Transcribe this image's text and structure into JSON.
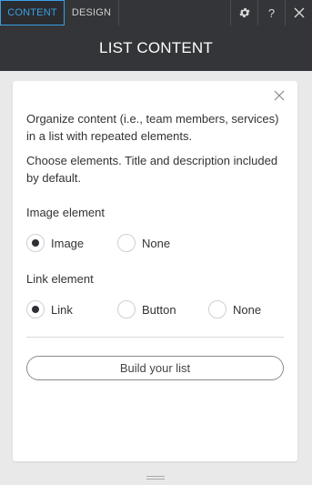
{
  "topbar": {
    "tabs": [
      {
        "label": "CONTENT",
        "active": true
      },
      {
        "label": "DESIGN",
        "active": false
      }
    ],
    "icons": [
      "gear-icon",
      "help-icon",
      "close-icon"
    ],
    "help_label": "?"
  },
  "header": {
    "title": "LIST CONTENT"
  },
  "panel": {
    "description_1": "Organize content (i.e., team members, services) in a list with repeated elements.",
    "description_2": "Choose elements. Title and description included by default.",
    "image_section": {
      "label": "Image element",
      "options": [
        {
          "label": "Image",
          "selected": true
        },
        {
          "label": "None",
          "selected": false
        }
      ]
    },
    "link_section": {
      "label": "Link element",
      "options": [
        {
          "label": "Link",
          "selected": true
        },
        {
          "label": "Button",
          "selected": false
        },
        {
          "label": "None",
          "selected": false
        }
      ]
    },
    "build_button": "Build your list"
  },
  "colors": {
    "topbar_bg": "#333538",
    "active_tab": "#3aa0e6",
    "page_bg": "#e9e9e9",
    "card_bg": "#ffffff"
  }
}
